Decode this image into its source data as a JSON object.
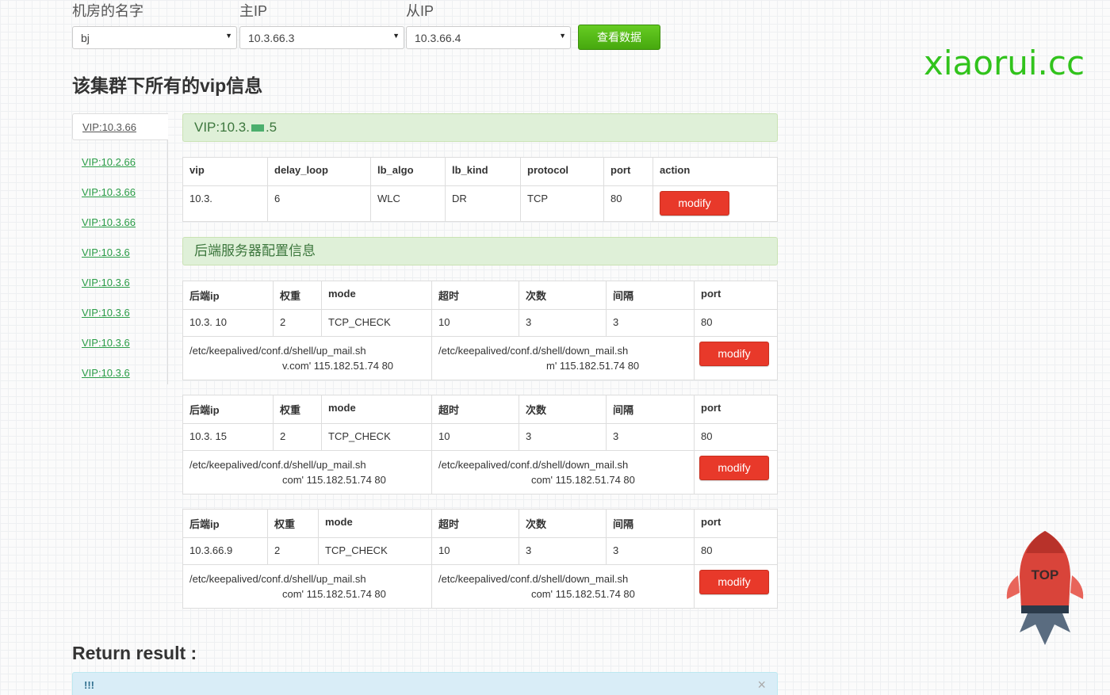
{
  "selectors": {
    "room": {
      "label": "机房的名字",
      "value": "bj"
    },
    "master_ip": {
      "label": "主IP",
      "value": "10.3.66.3"
    },
    "slave_ip": {
      "label": "从IP",
      "value": "10.3.66.4"
    },
    "view_button": "查看数据"
  },
  "brand": "xiaorui.cc",
  "page_title": "该集群下所有的vip信息",
  "sidebar": {
    "items": [
      {
        "label": "VIP:10.3.66"
      },
      {
        "label": "VIP:10.2.66"
      },
      {
        "label": "VIP:10.3.66"
      },
      {
        "label": "VIP:10.3.66"
      },
      {
        "label": "VIP:10.3.6"
      },
      {
        "label": "VIP:10.3.6"
      },
      {
        "label": "VIP:10.3.6"
      },
      {
        "label": "VIP:10.3.6"
      },
      {
        "label": "VIP:10.3.6"
      }
    ]
  },
  "vip_panel": {
    "title": "VIP:10.3.",
    "title_suffix": ".5",
    "headers": [
      "vip",
      "delay_loop",
      "lb_algo",
      "lb_kind",
      "protocol",
      "port",
      "action"
    ],
    "row": {
      "vip": "10.3.",
      "delay_loop": "6",
      "lb_algo": "WLC",
      "lb_kind": "DR",
      "protocol": "TCP",
      "port": "80",
      "action": "modify"
    }
  },
  "backend_panel_title": "后端服务器配置信息",
  "backend_headers": [
    "后端ip",
    "权重",
    "mode",
    "超时",
    "次数",
    "间隔",
    "port"
  ],
  "backends": [
    {
      "ip": "10.3.",
      "ip_suffix": "10",
      "weight": "2",
      "mode": "TCP_CHECK",
      "timeout": "10",
      "count": "3",
      "interval": "3",
      "port": "80",
      "up_script": "/etc/keepalived/conf.d/shell/up_mail.sh",
      "up_args": "v.com' 115.182.51.74 80",
      "down_script": "/etc/keepalived/conf.d/shell/down_mail.sh",
      "down_args": "m' 115.182.51.74 80",
      "modify": "modify"
    },
    {
      "ip": "10.3.",
      "ip_suffix": "15",
      "weight": "2",
      "mode": "TCP_CHECK",
      "timeout": "10",
      "count": "3",
      "interval": "3",
      "port": "80",
      "up_script": "/etc/keepalived/conf.d/shell/up_mail.sh",
      "up_args": "com' 115.182.51.74 80",
      "down_script": "/etc/keepalived/conf.d/shell/down_mail.sh",
      "down_args": "com' 115.182.51.74 80",
      "modify": "modify"
    },
    {
      "ip": "10.3.66.9",
      "ip_suffix": "",
      "weight": "2",
      "mode": "TCP_CHECK",
      "timeout": "10",
      "count": "3",
      "interval": "3",
      "port": "80",
      "up_script": "/etc/keepalived/conf.d/shell/up_mail.sh",
      "up_args": "com' 115.182.51.74 80",
      "down_script": "/etc/keepalived/conf.d/shell/down_mail.sh",
      "down_args": "com' 115.182.51.74 80",
      "modify": "modify"
    }
  ],
  "return_title": "Return result :",
  "alert": {
    "text": "!!!",
    "close": "×"
  },
  "top_button": "TOP"
}
